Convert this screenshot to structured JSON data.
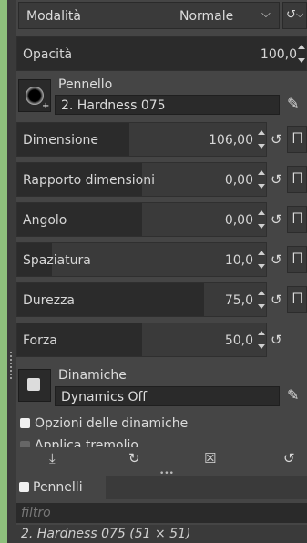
{
  "mode": {
    "label": "Modalità",
    "value": "Normale"
  },
  "opacity": {
    "label": "Opacità",
    "value": "100,0"
  },
  "brush": {
    "section_label": "Pennello",
    "name": "2. Hardness 075"
  },
  "sliders": [
    {
      "label": "Dimensione",
      "value": "106,00",
      "fill": 0.45
    },
    {
      "label": "Rapporto dimensioni",
      "value": "0,00",
      "fill": 0.5
    },
    {
      "label": "Angolo",
      "value": "0,00",
      "fill": 0.5
    },
    {
      "label": "Spaziatura",
      "value": "10,0",
      "fill": 0.14
    },
    {
      "label": "Durezza",
      "value": "75,0",
      "fill": 0.75
    },
    {
      "label": "Forza",
      "value": "50,0",
      "fill": 0.5
    }
  ],
  "dynamics": {
    "section_label": "Dinamiche",
    "name": "Dynamics Off"
  },
  "dynamics_options": {
    "label": "Opzioni delle dinamiche"
  },
  "tremolo": {
    "label": "Applica tremolio"
  },
  "brushes_tab": {
    "label": "Pennelli"
  },
  "brushes_filter": {
    "placeholder": "filtro"
  },
  "brushes_status": {
    "text": "2. Hardness 075 (51 × 51)"
  },
  "colors": {
    "background": "#454545",
    "slider_fill": "#2b2b2b",
    "outer": "#8ec07c"
  }
}
